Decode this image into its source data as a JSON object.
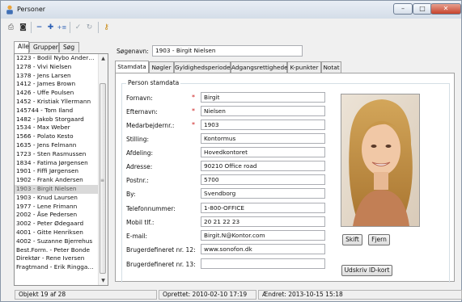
{
  "window": {
    "title": "Personer",
    "controls": {
      "minimize": "–",
      "maximize": "□",
      "close": "✕"
    }
  },
  "toolbar": {
    "icons": [
      "print-icon",
      "binoculars-icon",
      "minus-icon",
      "plus-icon",
      "add-list-icon",
      "check-icon",
      "refresh-icon",
      "user-key-icon"
    ]
  },
  "left": {
    "tabs": [
      "Alle",
      "Grupper",
      "Søg"
    ],
    "active_tab": "Alle",
    "items": [
      "1223 - Bodil Nybo Ander…",
      "1278 - Vivi Nielsen",
      "1378 - Jens Larsen",
      "1412 - James Brown",
      "1426 - Uffe Poulsen",
      "1452 - Kristiak Yllermann",
      "145744 - Tom Iland",
      "1482 - Jakob Storgaard",
      "1534 - Max Weber",
      "1566 - Polato Kesto",
      "1635 - Jens Felmann",
      "1723 - Sten Rasmussen",
      "1834 - Fatima Jørgensen",
      "1901 - Fiffi Jørgensen",
      "1902 - Frank Andersen",
      "1903 - Birgit Nielsen",
      "1903 - Knud Laursen",
      "1977 - Lene Frimann",
      "2002 - Åse Pedersen",
      "3002 - Peter Ødegaard",
      "4001 - Gitte Henriksen",
      "4002 - Suzanne Bjerrehus",
      "Best.Form. - Peter Bonde",
      "Direktør - Rene Iversen",
      "Fragtmand - Erik Ringga…"
    ],
    "selected_index": 15
  },
  "search": {
    "label": "Søgenavn:",
    "value": "1903 - Birgit Nielsen"
  },
  "tabs": [
    "Stamdata",
    "Nøgler",
    "Gyldighedsperioder",
    "Adgangsrettigheder",
    "K-punkter",
    "Notat"
  ],
  "active_tab": "Stamdata",
  "group_title": "Person stamdata",
  "fields": [
    {
      "label": "Fornavn:",
      "value": "Birgit",
      "required": true
    },
    {
      "label": "Efternavn:",
      "value": "Nielsen",
      "required": true
    },
    {
      "label": "Medarbejdernr.:",
      "value": "1903",
      "required": true
    },
    {
      "label": "Stilling:",
      "value": "Kontormus",
      "required": false
    },
    {
      "label": "Afdeling:",
      "value": "Hovedkontoret",
      "required": false
    },
    {
      "label": "Adresse:",
      "value": "90210 Office road",
      "required": false
    },
    {
      "label": "Postnr.:",
      "value": "5700",
      "required": false
    },
    {
      "label": "By:",
      "value": "Svendborg",
      "required": false
    },
    {
      "label": "Telefonnummer:",
      "value": "1-800-OFFICE",
      "required": false
    },
    {
      "label": "Mobil tlf.:",
      "value": "20 21 22 23",
      "required": false
    },
    {
      "label": "E-mail:",
      "value": "Birgit.N@Kontor.com",
      "required": false
    },
    {
      "label": "Brugerdefineret nr. 12:",
      "value": "www.sonofon.dk",
      "required": false
    },
    {
      "label": "Brugerdefineret nr. 13:",
      "value": "",
      "required": false
    }
  ],
  "required_mark": "*",
  "buttons": {
    "change": "Skift",
    "remove": "Fjern",
    "print_id": "Udskriv ID-kort"
  },
  "status": {
    "count": "Objekt 19 af 28",
    "created": "Oprettet: 2010-02-10  17:19",
    "modified": "Ændret: 2013-10-15  15:18"
  },
  "colors": {
    "required": "#cc1b1b",
    "selected_row": "#d9d9d9",
    "titlebar": "#dce4ee"
  }
}
